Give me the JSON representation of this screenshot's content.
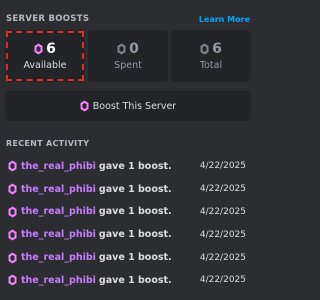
{
  "header": {
    "title": "SERVER BOOSTS",
    "learn_more": "Learn More"
  },
  "stats": [
    {
      "value": "6",
      "label": "Available",
      "highlight": true
    },
    {
      "value": "0",
      "label": "Spent"
    },
    {
      "value": "6",
      "label": "Total"
    }
  ],
  "boost_button": {
    "label": "Boost This Server"
  },
  "recent": {
    "title": "RECENT ACTIVITY",
    "items": [
      {
        "user": "the_real_phibi",
        "action": "gave 1 boost.",
        "date": "4/22/2025"
      },
      {
        "user": "the_real_phibi",
        "action": "gave 1 boost.",
        "date": "4/22/2025"
      },
      {
        "user": "the_real_phibi",
        "action": "gave 1 boost.",
        "date": "4/22/2025"
      },
      {
        "user": "the_real_phibi",
        "action": "gave 1 boost.",
        "date": "4/22/2025"
      },
      {
        "user": "the_real_phibi",
        "action": "gave 1 boost.",
        "date": "4/22/2025"
      },
      {
        "user": "the_real_phibi",
        "action": "gave 1 boost.",
        "date": "4/22/2025"
      }
    ]
  },
  "colors": {
    "background": "#2b2d31",
    "card": "#232428",
    "accent_link": "#00a8fc",
    "boost_pink": "#ff73fa",
    "username": "#c77dff",
    "highlight_border": "#e32a2a"
  },
  "icons": {
    "boost": "boost-gem-icon"
  }
}
